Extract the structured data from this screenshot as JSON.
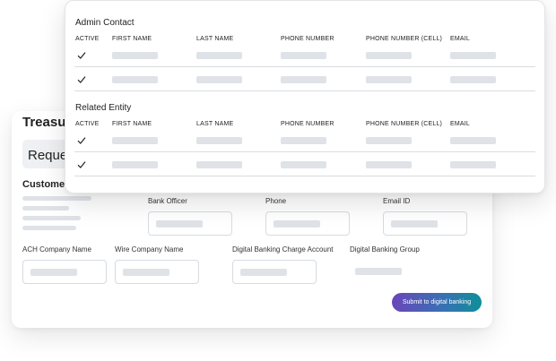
{
  "back_card": {
    "title": "Treasury",
    "request_label": "Reque",
    "customer_label": "Customer",
    "fields": {
      "bank_officer": "Bank Officer",
      "phone": "Phone",
      "email_id": "Email ID",
      "ach_company_name": "ACH Company Name",
      "wire_company_name": "Wire Company Name",
      "digital_banking_charge_account": "Digital Banking Charge Account",
      "digital_banking_group": "Digital Banking Group"
    },
    "submit_label": "Submit to digital banking",
    "colors": {
      "submit_gradient_start": "#6a46b8",
      "submit_gradient_end": "#0f8f99"
    }
  },
  "front_card": {
    "sections": [
      {
        "title": "Admin Contact",
        "columns": [
          "ACTIVE",
          "FIRST NAME",
          "LAST NAME",
          "PHONE NUMBER",
          "PHONE NUMBER (CELL)",
          "EMAIL"
        ],
        "rows": [
          {
            "active": true
          },
          {
            "active": true
          }
        ]
      },
      {
        "title": "Related Entity",
        "columns": [
          "ACTIVE",
          "FIRST NAME",
          "LAST NAME",
          "PHONE NUMBER",
          "PHONE NUMBER (CELL)",
          "EMAIL"
        ],
        "rows": [
          {
            "active": true
          },
          {
            "active": true
          }
        ]
      }
    ],
    "icons": {
      "checkbox": "checkmark-icon"
    }
  }
}
